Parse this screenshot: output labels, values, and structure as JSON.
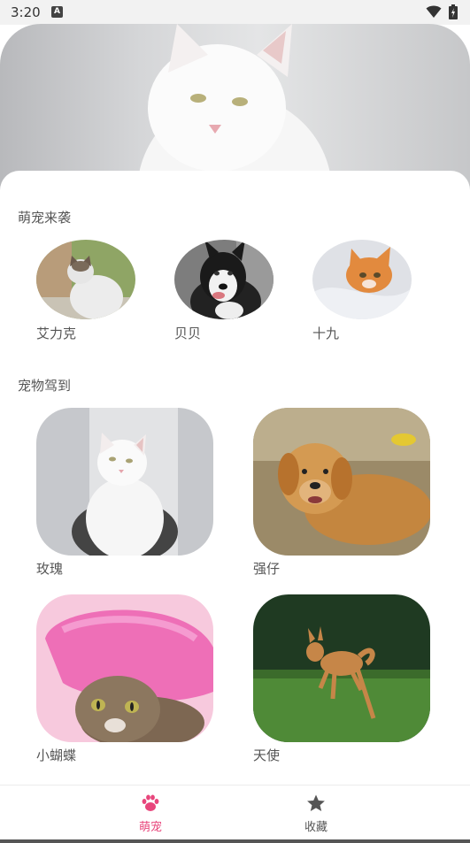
{
  "status": {
    "time": "3:20",
    "notification_badge": "A"
  },
  "sections": {
    "featured_title": "萌宠来袭",
    "grid_title": "宠物驾到"
  },
  "featured": [
    {
      "name": "艾力克"
    },
    {
      "name": "贝贝"
    },
    {
      "name": "十九"
    }
  ],
  "grid": [
    {
      "name": "玫瑰"
    },
    {
      "name": "强仔"
    },
    {
      "name": "小蝴蝶"
    },
    {
      "name": "天使"
    }
  ],
  "nav": [
    {
      "label": "萌宠",
      "icon": "paw-icon",
      "active": true
    },
    {
      "label": "收藏",
      "icon": "star-icon",
      "active": false
    }
  ],
  "colors": {
    "accent": "#e8467c",
    "text": "#555555",
    "nav_inactive_icon": "#555555"
  }
}
